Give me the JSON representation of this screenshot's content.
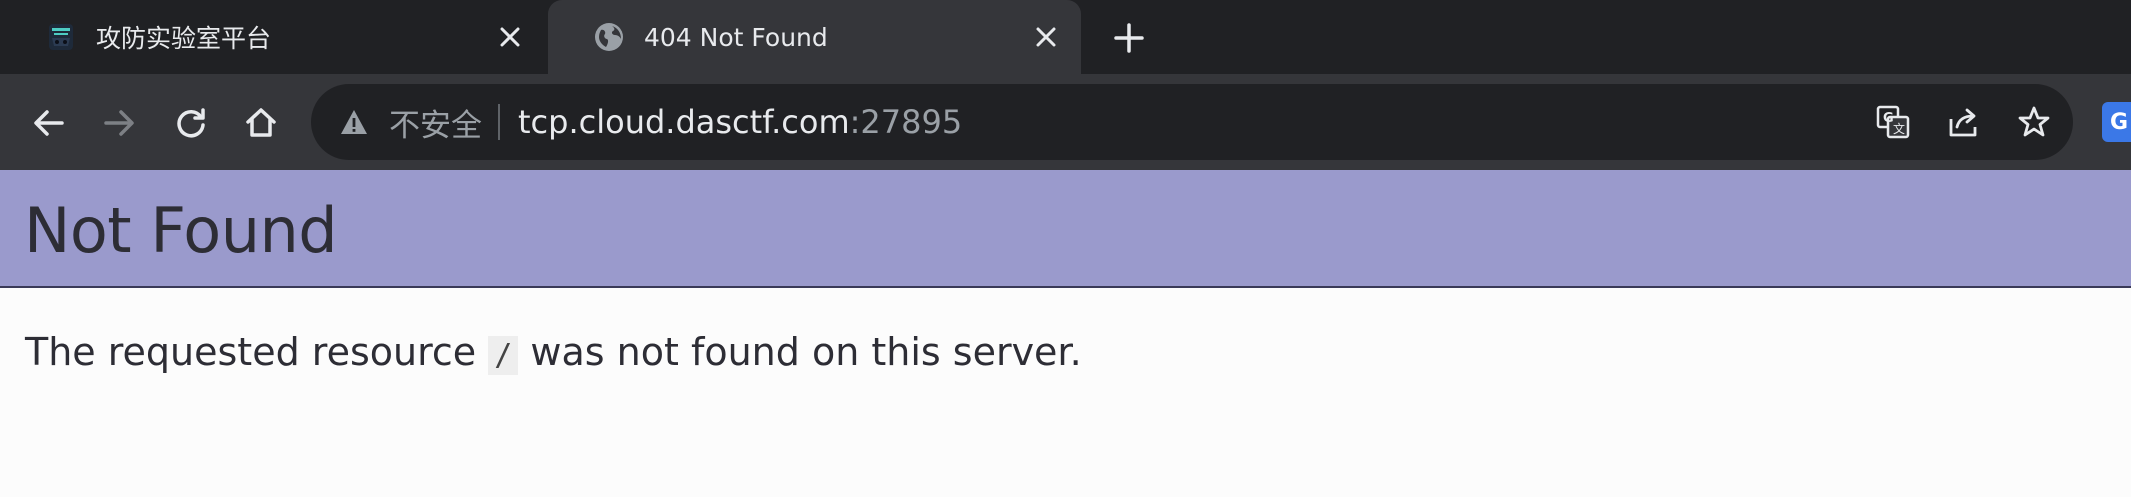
{
  "browser": {
    "tabs": [
      {
        "title": "攻防实验室平台",
        "icon": "shield-logo-icon",
        "active": false
      },
      {
        "title": "404 Not Found",
        "icon": "globe-icon",
        "active": true
      }
    ],
    "address_bar": {
      "security_label": "不安全",
      "host": "tcp.cloud.dasctf.com",
      "port": ":27895"
    },
    "extension_label": "G"
  },
  "page": {
    "heading": "Not Found",
    "message_prefix": "The requested resource",
    "resource": "/",
    "message_suffix": "was not found on this server.",
    "banner_color": "#9a9acc"
  }
}
